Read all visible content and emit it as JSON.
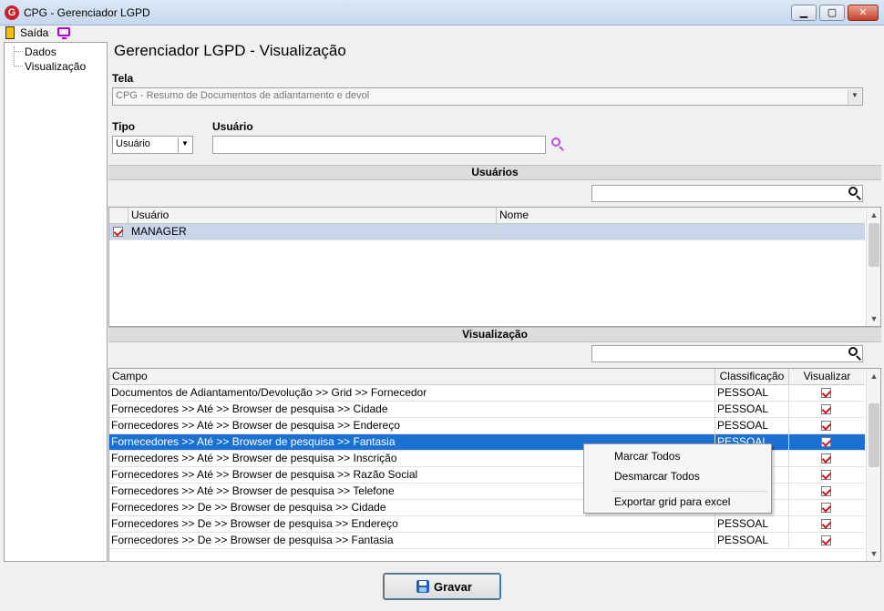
{
  "window": {
    "logo_letter": "G",
    "title": "CPG - Gerenciador LGPD",
    "minimize_glyph": "▁",
    "maximize_glyph": "▢",
    "close_glyph": "✕"
  },
  "toolbar": {
    "exit_label": "Saída",
    "exit_icon": "exit-door-icon",
    "monitor_icon": "monitor-icon"
  },
  "tree": {
    "items": [
      {
        "label": "Dados"
      },
      {
        "label": "Visualização"
      }
    ]
  },
  "main": {
    "page_title": "Gerenciador LGPD - Visualização",
    "tela_label": "Tela",
    "tela_value": "CPG - Resumo de Documentos de adiantamento e devol",
    "tipo_label": "Tipo",
    "tipo_value": "Usuário",
    "usuario_label": "Usuário",
    "usuario_value": ""
  },
  "users_section": {
    "title": "Usuários",
    "search_value": "",
    "columns": [
      "Usuário",
      "Nome"
    ],
    "rows": [
      {
        "checked": true,
        "usuario": "MANAGER",
        "nome": ""
      }
    ]
  },
  "view_section": {
    "title": "Visualização",
    "search_value": "",
    "columns": [
      "Campo",
      "Classificação",
      "Visualizar"
    ],
    "rows": [
      {
        "campo": "Documentos de Adiantamento/Devolução >> Grid >> Fornecedor",
        "classificacao": "PESSOAL",
        "visualizar": true
      },
      {
        "campo": "Fornecedores >> Até >> Browser de pesquisa >> Cidade",
        "classificacao": "PESSOAL",
        "visualizar": true
      },
      {
        "campo": "Fornecedores >> Até >> Browser de pesquisa >> Endereço",
        "classificacao": "PESSOAL",
        "visualizar": true
      },
      {
        "campo": "Fornecedores >> Até >> Browser de pesquisa >> Fantasia",
        "classificacao": "PESSOAL",
        "visualizar": true
      },
      {
        "campo": "Fornecedores >> Até >> Browser de pesquisa >> Inscrição",
        "classificacao": "",
        "visualizar": true
      },
      {
        "campo": "Fornecedores >> Até >> Browser de pesquisa >> Razão Social",
        "classificacao": "",
        "visualizar": true
      },
      {
        "campo": "Fornecedores >> Até >> Browser de pesquisa >> Telefone",
        "classificacao": "",
        "visualizar": true
      },
      {
        "campo": "Fornecedores >> De >> Browser de pesquisa >> Cidade",
        "classificacao": "",
        "visualizar": true
      },
      {
        "campo": "Fornecedores >> De >> Browser de pesquisa >> Endereço",
        "classificacao": "PESSOAL",
        "visualizar": true
      },
      {
        "campo": "Fornecedores >> De >> Browser de pesquisa >> Fantasia",
        "classificacao": "PESSOAL",
        "visualizar": true
      }
    ]
  },
  "context_menu": {
    "items": [
      "Marcar Todos",
      "Desmarcar Todos",
      "Exportar grid para excel"
    ]
  },
  "footer": {
    "save_label": "Gravar"
  },
  "colors": {
    "selection": "#1b70d4",
    "check_mark": "#d0141a",
    "search_accent": "#b84fd8"
  }
}
